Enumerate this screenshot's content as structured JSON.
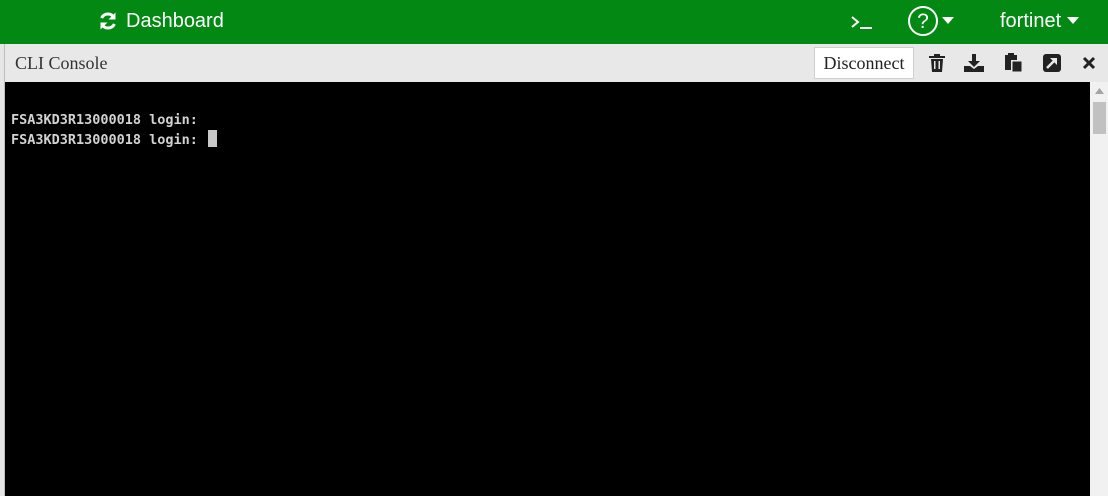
{
  "topbar": {
    "dashboard_label": "Dashboard",
    "cli_icon": "terminal-icon",
    "help_symbol": "?",
    "user_label": "fortinet",
    "bg_color": "#038913"
  },
  "panel": {
    "title": "CLI Console",
    "disconnect_label": "Disconnect",
    "tools": [
      "trash-icon",
      "download-icon",
      "clipboard-icon",
      "expand-icon",
      "close-icon"
    ]
  },
  "terminal": {
    "lines": [
      "FSA3KD3R13000018 login:",
      "FSA3KD3R13000018 login: "
    ]
  }
}
